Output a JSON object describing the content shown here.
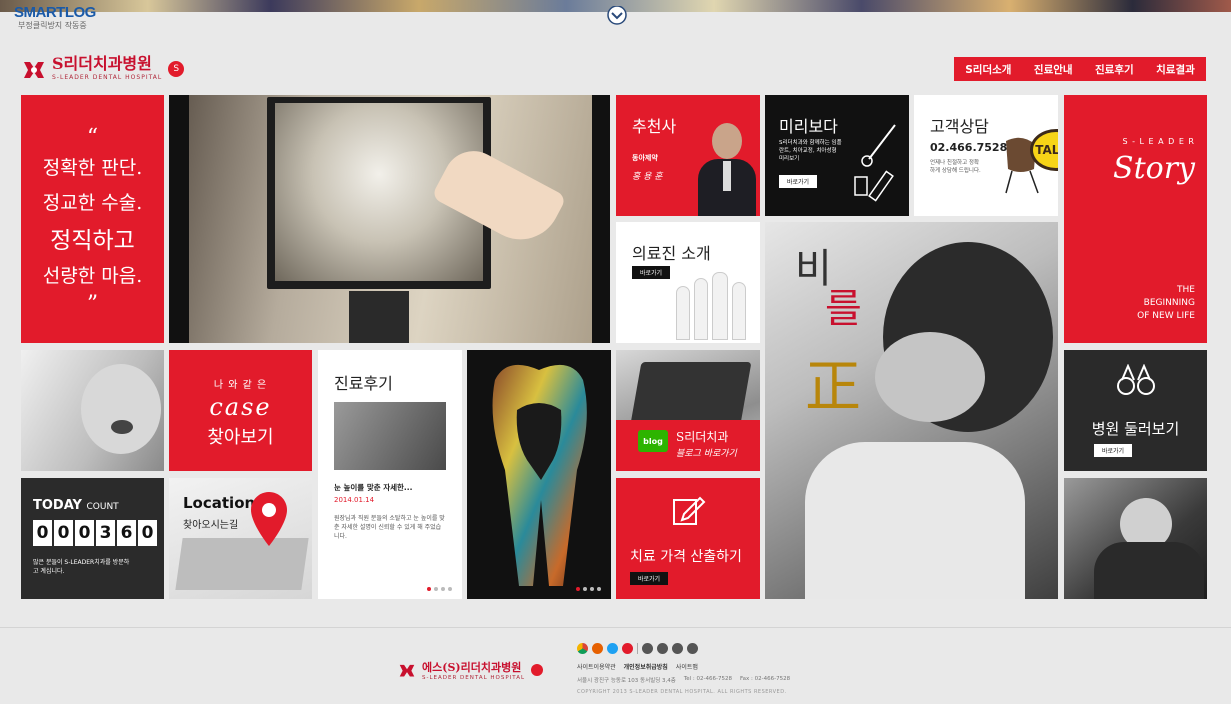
{
  "header": {
    "smartlog_title": "SMARTLOG",
    "smartlog_sub": "부정클릭방지 작동중",
    "logo_title": "S리더치과병원",
    "logo_sub": "S-LEADER DENTAL HOSPITAL",
    "logo_badge": "S"
  },
  "nav": {
    "items": [
      "S리더소개",
      "진료안내",
      "진료후기",
      "치료결과"
    ]
  },
  "tiles": {
    "motto": {
      "open_quote": "“",
      "lines": [
        "정확한 판단.",
        "정교한 수술.",
        "정직하고",
        "선량한 마음."
      ],
      "close_quote": "”"
    },
    "recommend": {
      "title": "추천사",
      "brand": "동아제약",
      "sign": "홍 용 훈"
    },
    "preview": {
      "title": "미리보다",
      "desc": "S리더치과와 함께하는 임플란트, 치아교정, 치아성형 미리보기",
      "button": "바로가기"
    },
    "consult": {
      "title": "고객상담",
      "phone": "02.466.7528",
      "desc": "언제나 친절하고 정확하게 상담해 드립니다.",
      "talk": "TALK"
    },
    "story": {
      "top": "S - L E A D E R",
      "title": "Story",
      "tagline1": "THE",
      "tagline2": "BEGINNING",
      "tagline3": "OF NEW LIFE"
    },
    "staff": {
      "title": "의료진 소개",
      "button": "바로가기"
    },
    "calligraphy": {
      "line1": "비",
      "line2": "를",
      "line3": "正"
    },
    "case": {
      "line1": "나 와 같 은",
      "line2": "case",
      "line3": "찾아보기"
    },
    "review": {
      "title": "진료후기",
      "headline": "눈 높이를 맞춘 자세한...",
      "date": "2014.01.14",
      "body": "원장님과 직원 분들의 소탈하고 눈 높이를 맞춘 자세한 설명이 신뢰할 수 있게 해 주었습니다."
    },
    "blog": {
      "badge": "blog",
      "line1": "S리더치과",
      "line2": "블로그 바로가기"
    },
    "tour": {
      "title": "병원 둘러보기",
      "button": "바로가기"
    },
    "today": {
      "title": "TODAY",
      "title_small": "COUNT",
      "digits": [
        "0",
        "0",
        "0",
        "3",
        "6",
        "0"
      ],
      "desc": "많은 분들이 S-LEADER치과를 방문하고 계십니다."
    },
    "location": {
      "title": "Location",
      "sub": "찾아오시는길"
    },
    "price": {
      "title": "치료 가격 산출하기",
      "button": "바로가기"
    }
  },
  "footer": {
    "logo_title": "에스(S)리더치과병원",
    "logo_sub": "S-LEADER DENTAL HOSPITAL",
    "links": [
      "사이트이용약관",
      "개인정보취급방침",
      "사이트맵"
    ],
    "address": "서울시 광진구 능동로 103 동서빌딩 3,4층",
    "tel": "Tel : 02-466-7528",
    "fax": "Fax : 02-466-7528",
    "copyright": "COPYRIGHT 2013 S-LEADER DENTAL HOSPITAL. ALL RIGHTS RESERVED."
  },
  "colors": {
    "brand": "#e21b2b",
    "dark": "#222222",
    "page": "#e9e9e9"
  }
}
